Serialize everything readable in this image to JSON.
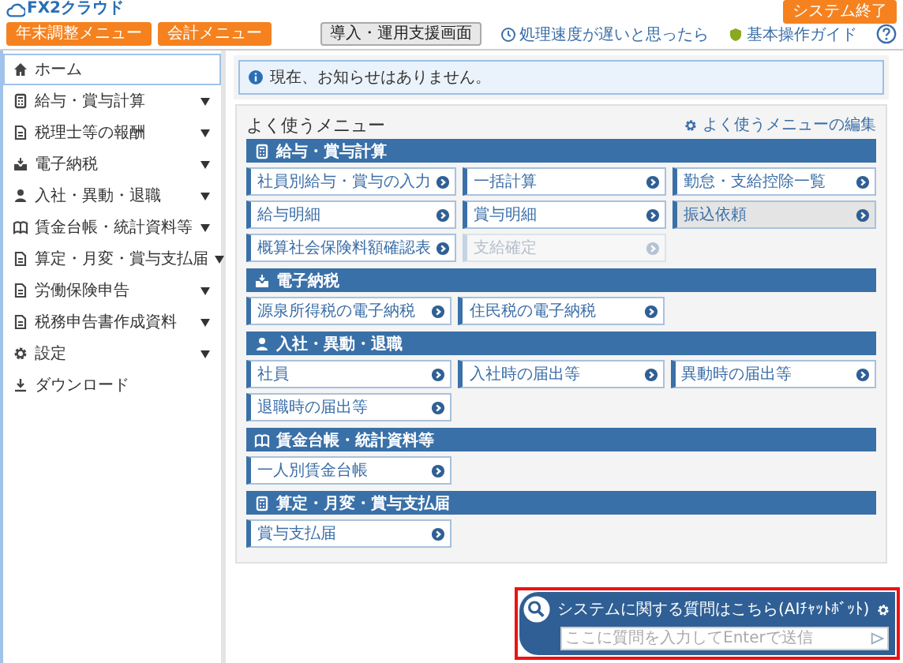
{
  "header": {
    "logo": "FX2クラウド",
    "exit_button": "システム終了",
    "menu_buttons": [
      "年末調整メニュー",
      "会計メニュー"
    ],
    "support_button": "導入・運用支援画面",
    "links": [
      "処理速度が遅いと思ったら",
      "基本操作ガイド"
    ]
  },
  "sidebar": {
    "items": [
      {
        "label": "ホーム",
        "selected": true,
        "has_submenu": false
      },
      {
        "label": "給与・賞与計算",
        "selected": false,
        "has_submenu": true
      },
      {
        "label": "税理士等の報酬",
        "selected": false,
        "has_submenu": true
      },
      {
        "label": "電子納税",
        "selected": false,
        "has_submenu": true
      },
      {
        "label": "入社・異動・退職",
        "selected": false,
        "has_submenu": true
      },
      {
        "label": "賃金台帳・統計資料等",
        "selected": false,
        "has_submenu": true
      },
      {
        "label": "算定・月変・賞与支払届",
        "selected": false,
        "has_submenu": true
      },
      {
        "label": "労働保険申告",
        "selected": false,
        "has_submenu": true
      },
      {
        "label": "税務申告書作成資料",
        "selected": false,
        "has_submenu": true
      },
      {
        "label": "設定",
        "selected": false,
        "has_submenu": true
      },
      {
        "label": "ダウンロード",
        "selected": false,
        "has_submenu": false
      }
    ]
  },
  "notice": "現在、お知らせはありません。",
  "menu": {
    "title": "よく使うメニュー",
    "edit_link": "よく使うメニューの編集",
    "sections": [
      {
        "title": "給与・賞与計算",
        "items": [
          {
            "label": "社員別給与・賞与の入力",
            "selected": false,
            "disabled": false
          },
          {
            "label": "一括計算",
            "selected": false,
            "disabled": false
          },
          {
            "label": "勤怠・支給控除一覧",
            "selected": false,
            "disabled": false
          },
          {
            "label": "給与明細",
            "selected": false,
            "disabled": false
          },
          {
            "label": "賞与明細",
            "selected": false,
            "disabled": false
          },
          {
            "label": "振込依頼",
            "selected": true,
            "disabled": false
          },
          {
            "label": "概算社会保険料額確認表",
            "selected": false,
            "disabled": false
          },
          {
            "label": "支給確定",
            "selected": false,
            "disabled": true
          }
        ]
      },
      {
        "title": "電子納税",
        "items": [
          {
            "label": "源泉所得税の電子納税",
            "selected": false,
            "disabled": false
          },
          {
            "label": "住民税の電子納税",
            "selected": false,
            "disabled": false
          }
        ]
      },
      {
        "title": "入社・異動・退職",
        "items": [
          {
            "label": "社員",
            "selected": false,
            "disabled": false
          },
          {
            "label": "入社時の届出等",
            "selected": false,
            "disabled": false
          },
          {
            "label": "異動時の届出等",
            "selected": false,
            "disabled": false
          },
          {
            "label": "退職時の届出等",
            "selected": false,
            "disabled": false
          }
        ]
      },
      {
        "title": "賃金台帳・統計資料等",
        "items": [
          {
            "label": "一人別賃金台帳",
            "selected": false,
            "disabled": false
          }
        ]
      },
      {
        "title": "算定・月変・賞与支払届",
        "items": [
          {
            "label": "賞与支払届",
            "selected": false,
            "disabled": false
          }
        ]
      }
    ]
  },
  "chat": {
    "title": "システムに関する質問はこちら(AIﾁｬｯﾄﾎﾞｯﾄ)",
    "placeholder": "ここに質問を入力してEnterで送信"
  }
}
